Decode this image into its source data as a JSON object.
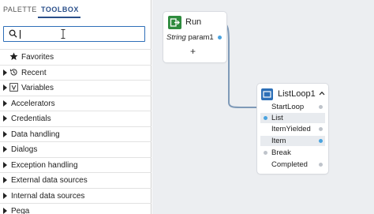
{
  "tabs": {
    "palette": "PALETTE",
    "toolbox": "TOOLBOX",
    "active": "TOOLBOX"
  },
  "search": {
    "value": "",
    "placeholder": ""
  },
  "tree": [
    {
      "label": "Favorites",
      "icon": "star-icon"
    },
    {
      "label": "Recent",
      "icon": "history-icon",
      "expandable": true
    },
    {
      "label": "Variables",
      "icon": "variable-icon",
      "expandable": true
    },
    {
      "label": "Accelerators",
      "expandable": true
    },
    {
      "label": "Credentials",
      "expandable": true
    },
    {
      "label": "Data handling",
      "expandable": true
    },
    {
      "label": "Dialogs",
      "expandable": true
    },
    {
      "label": "Exception handling",
      "expandable": true
    },
    {
      "label": "External data sources",
      "expandable": true
    },
    {
      "label": "Internal data sources",
      "expandable": true
    },
    {
      "label": "Pega",
      "expandable": true
    }
  ],
  "nodes": {
    "run": {
      "title": "Run",
      "icon": "run-icon",
      "param_type": "String",
      "param_name": "param1",
      "add_label": "+"
    },
    "listloop": {
      "title": "ListLoop1",
      "icon": "loop-icon",
      "ports": [
        {
          "label": "StartLoop",
          "side": "right",
          "color": "#bfc4cb"
        },
        {
          "label": "List",
          "side": "left",
          "color": "#4aa3df",
          "highlighted": true
        },
        {
          "label": "ItemYielded",
          "side": "right",
          "color": "#bfc4cb"
        },
        {
          "label": "Item",
          "side": "right",
          "color": "#4aa3df",
          "highlighted": true
        },
        {
          "label": "Break",
          "side": "left",
          "color": "#bfc4cb"
        },
        {
          "label": "Completed",
          "side": "right",
          "color": "#bfc4cb"
        }
      ]
    }
  },
  "colors": {
    "accent": "#2a4f8a",
    "run_icon": "#2e8b3e",
    "loop_icon": "#2c6fb7",
    "link": "#7f9ab8"
  }
}
